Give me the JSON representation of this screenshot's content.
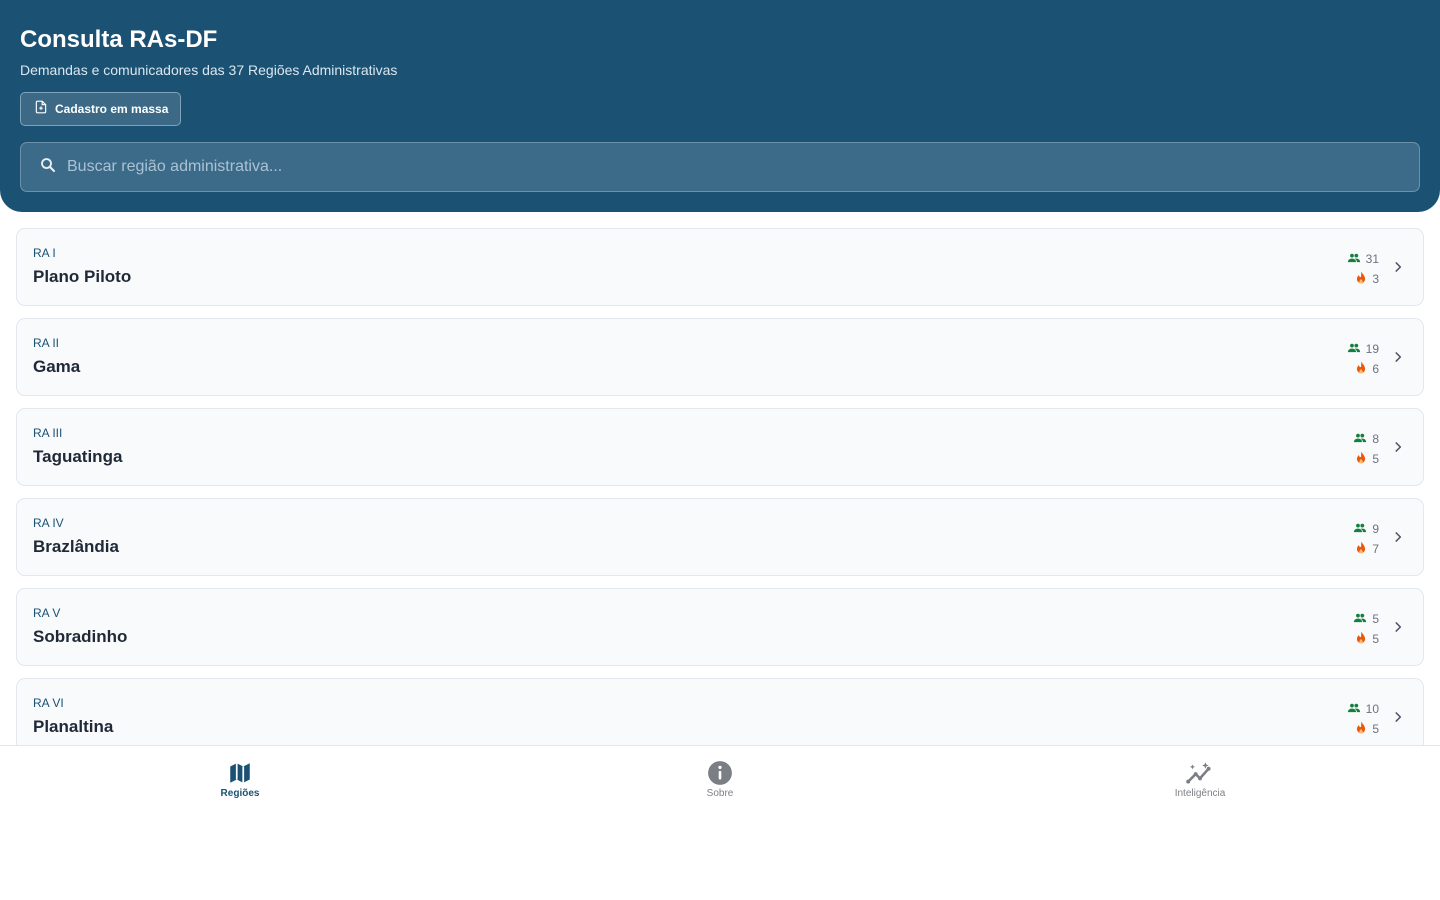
{
  "header": {
    "title": "Consulta RAs-DF",
    "subtitle": "Demandas e comunicadores das 37 Regiões Administrativas",
    "bulk_button_label": "Cadastro em massa",
    "search_placeholder": "Buscar região administrativa..."
  },
  "regions": [
    {
      "code": "RA I",
      "name": "Plano Piloto",
      "communicators": "31",
      "demands": "3"
    },
    {
      "code": "RA II",
      "name": "Gama",
      "communicators": "19",
      "demands": "6"
    },
    {
      "code": "RA III",
      "name": "Taguatinga",
      "communicators": "8",
      "demands": "5"
    },
    {
      "code": "RA IV",
      "name": "Brazlândia",
      "communicators": "9",
      "demands": "7"
    },
    {
      "code": "RA V",
      "name": "Sobradinho",
      "communicators": "5",
      "demands": "5"
    },
    {
      "code": "RA VI",
      "name": "Planaltina",
      "communicators": "10",
      "demands": "5"
    }
  ],
  "nav": {
    "items": [
      {
        "label": "Regiões",
        "icon": "map-icon",
        "active": true
      },
      {
        "label": "Sobre",
        "icon": "info-icon",
        "active": false
      },
      {
        "label": "Inteligência",
        "icon": "insights-icon",
        "active": false
      }
    ]
  },
  "colors": {
    "primary": "#1b5173",
    "communicators": "#15803d",
    "demands": "#ea580c",
    "nav_inactive": "#7b7f85"
  }
}
